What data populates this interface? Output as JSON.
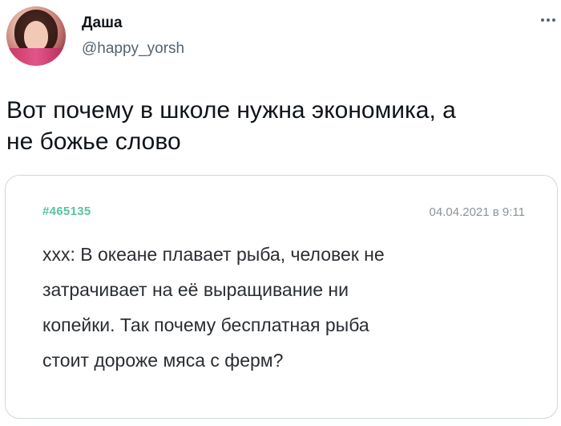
{
  "author": {
    "display_name": "Даша",
    "handle": "@happy_yorsh"
  },
  "tweet": {
    "text": "Вот почему в школе нужна экономика, а\nне божье слово"
  },
  "quote": {
    "id": "#465135",
    "date": "04.04.2021 в 9:11",
    "text": "xxx: В океане плавает рыба, человек не\nзатрачивает на её выращивание ни\nкопейки. Так почему бесплатная рыба\nстоит дороже мяса с ферм?"
  },
  "icons": {
    "more": "more-horizontal-icon"
  },
  "colors": {
    "text_primary": "#0f1419",
    "text_secondary": "#536471",
    "card_border": "#cfd9de",
    "post_id_green": "#56c4a2",
    "date_gray": "#8b9398"
  }
}
